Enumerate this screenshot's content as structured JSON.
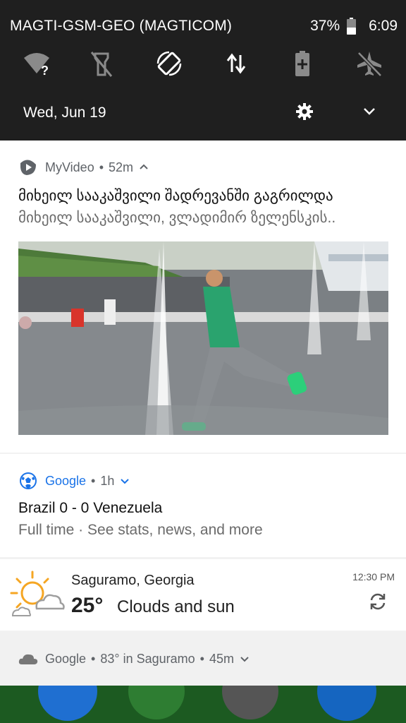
{
  "status_bar": {
    "carrier": "MAGTI-GSM-GEO (MAGTICOM)",
    "battery": "37%",
    "time": "6:09"
  },
  "quick_settings": {
    "tiles": [
      "wifi-unknown",
      "flashlight-off",
      "auto-rotate",
      "mobile-data",
      "battery-saver",
      "airplane-mode-off"
    ],
    "date": "Wed, Jun 19"
  },
  "notifications": {
    "myvideo": {
      "app": "MyVideo",
      "age": "52m",
      "title": "მიხეილ სააკაშვილი შადრევანში გაგრილდა",
      "text": "მიხეილ სააკაშვილი, ვლადიმირ ზელენსკის.."
    },
    "google_sports": {
      "app": "Google",
      "age": "1h",
      "title": "Brazil 0 - 0 Venezuela",
      "text": "Full time · See stats, news, and more"
    },
    "weather": {
      "location": "Saguramo, Georgia",
      "temp": "25°",
      "condition": "Clouds and sun",
      "time": "12:30 PM"
    },
    "google_weather": {
      "app": "Google",
      "temp_text": "83° in Saguramo",
      "age": "45m"
    }
  },
  "colors": {
    "panel_bg": "#1f1f1f",
    "google_blue": "#1a73e8",
    "sun_orange": "#f5a623"
  }
}
